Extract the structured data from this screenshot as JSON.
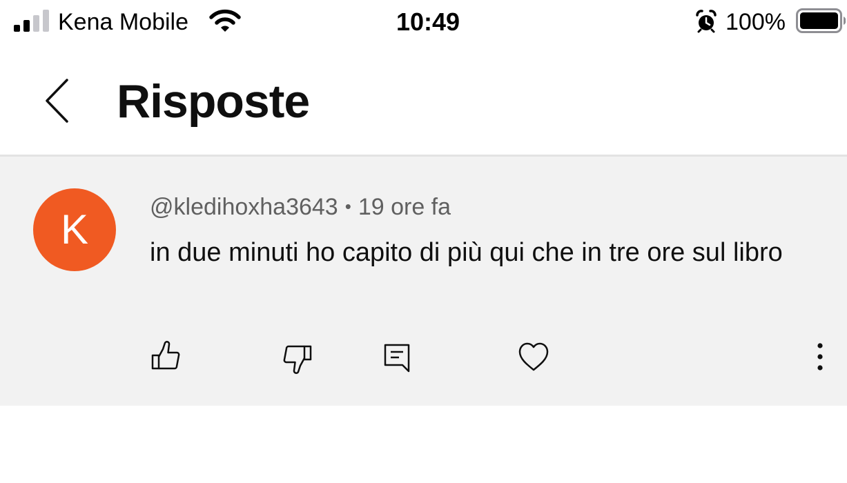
{
  "status_bar": {
    "carrier": "Kena Mobile",
    "time": "10:49",
    "battery": "100%",
    "icons": [
      "signal-icon",
      "wifi-icon",
      "alarm-icon",
      "battery-icon"
    ]
  },
  "header": {
    "title": "Risposte",
    "back_icon": "chevron-left-icon"
  },
  "comment": {
    "avatar_letter": "K",
    "avatar_color": "#f05a22",
    "author": "@kledihoxha3643",
    "separator": "•",
    "time_ago": "19 ore fa",
    "text": "in due minuti ho capito di più qui che in tre ore sul libro",
    "actions": [
      "thumbs-up-icon",
      "thumbs-down-icon",
      "reply-icon",
      "heart-icon",
      "more-vertical-icon"
    ]
  },
  "colors": {
    "comment_background": "#f2f2f2",
    "meta_text": "#606060",
    "primary_text": "#0f0f0f"
  }
}
